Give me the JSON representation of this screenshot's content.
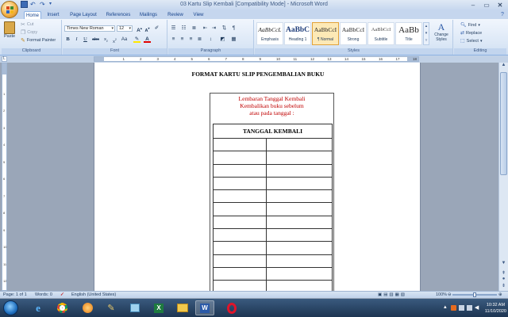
{
  "window": {
    "title": "03 Kartu Slip Kembali [Compatibility Mode] - Microsoft Word"
  },
  "tabs": [
    "Home",
    "Insert",
    "Page Layout",
    "References",
    "Mailings",
    "Review",
    "View"
  ],
  "ribbon": {
    "clipboard": {
      "paste": "Paste",
      "cut": "Cut",
      "copy": "Copy",
      "format_painter": "Format Painter",
      "label": "Clipboard"
    },
    "font": {
      "name": "Times New Roman",
      "size": "12",
      "label": "Font"
    },
    "paragraph": {
      "label": "Paragraph"
    },
    "styles": {
      "label": "Styles",
      "items": [
        {
          "sample": "AaBbCcL",
          "name": "Emphasis"
        },
        {
          "sample": "AaBbC",
          "name": "Heading 1"
        },
        {
          "sample": "AaBbCcI",
          "name": "¶ Normal"
        },
        {
          "sample": "AaBbCcI",
          "name": "Strong"
        },
        {
          "sample": "AaBbCcI",
          "name": "Subtitle"
        },
        {
          "sample": "AaBb",
          "name": "Title"
        }
      ],
      "change_styles": "Change Styles"
    },
    "editing": {
      "find": "Find",
      "replace": "Replace",
      "select": "Select",
      "label": "Editing"
    }
  },
  "document": {
    "heading": "FORMAT KARTU SLIP PENGEMBALIAN BUKU",
    "card_lines": [
      "Lembaran Tanggal Kembali",
      "Kembalikan buku sebelum",
      "atau pada tanggal :"
    ],
    "table_header": "TANGGAL KEMBALI",
    "row_count": 12
  },
  "status": {
    "page": "Page: 1 of 1",
    "words": "Words: 0",
    "language": "English (United States)",
    "zoom": "100%"
  },
  "taskbar": {
    "time": "10:32 AM",
    "date": "11/10/2020"
  },
  "colors": {
    "card_text": "#c00000",
    "ribbon_bg": "#dbe7f6",
    "selected_style": "#fde9b6"
  }
}
